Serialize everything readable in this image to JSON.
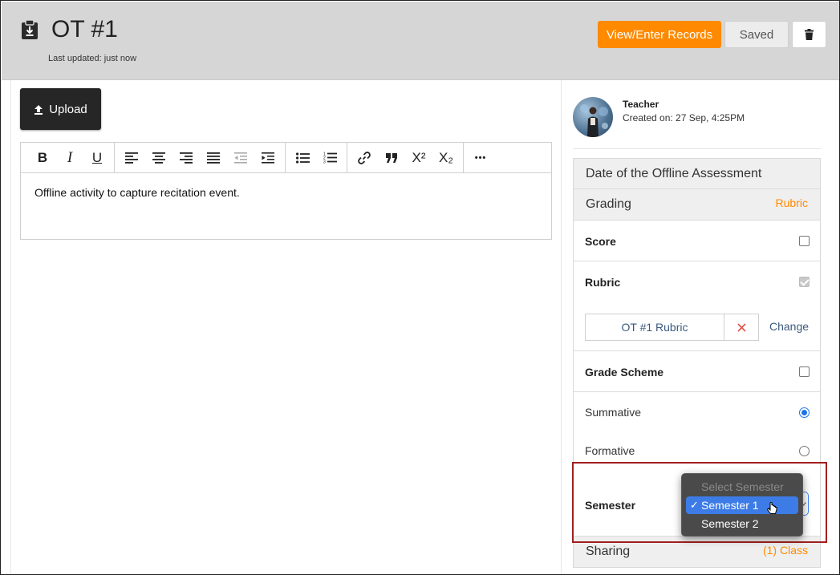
{
  "header": {
    "title": "OT #1",
    "last_updated": "Last updated: just now",
    "view_records_label": "View/Enter Records",
    "saved_label": "Saved",
    "colors": {
      "accent": "#ff8a00",
      "header_bg": "#d6d6d6"
    }
  },
  "editor": {
    "upload_label": "Upload",
    "toolbar": {
      "bold": "B",
      "italic": "I",
      "underline": "U",
      "superscript": "X²",
      "subscript": "X₂",
      "more": "•••"
    },
    "content": "Offline activity to capture recitation event."
  },
  "author": {
    "name": "Teacher",
    "created": "Created on: 27 Sep, 4:25PM"
  },
  "settings": {
    "date_label": "Date of the Offline Assessment",
    "grading_label": "Grading",
    "grading_value": "Rubric",
    "score_label": "Score",
    "rubric_label": "Rubric",
    "rubric_name": "OT #1 Rubric",
    "change_label": "Change",
    "grade_scheme_label": "Grade Scheme",
    "summative_label": "Summative",
    "formative_label": "Formative",
    "semester_label": "Semester",
    "sharing_label": "Sharing",
    "sharing_value": "(1) Class",
    "score_checked": false,
    "rubric_checked": true,
    "grade_scheme_checked": false,
    "assessment_type": "Summative"
  },
  "semester_dropdown": {
    "options": [
      {
        "label": "Select Semester",
        "disabled": true
      },
      {
        "label": "Semester 1",
        "selected": true
      },
      {
        "label": "Semester 2"
      }
    ],
    "check_mark": "✓"
  }
}
